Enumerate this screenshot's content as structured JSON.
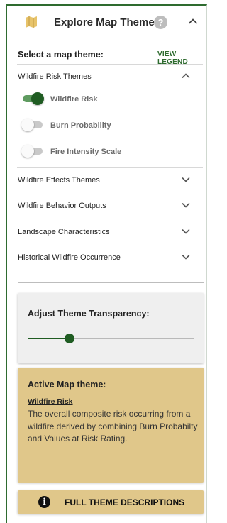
{
  "header": {
    "title": "Explore Map Themes",
    "help_glyph": "?",
    "icon": "map-icon"
  },
  "select": {
    "label": "Select a map theme:",
    "legend_link": "VIEW LEGEND"
  },
  "sections": [
    {
      "title": "Wildfire Risk Themes",
      "expanded": true,
      "toggles": [
        {
          "label": "Wildfire Risk",
          "on": true
        },
        {
          "label": "Burn Probability",
          "on": false
        },
        {
          "label": "Fire Intensity Scale",
          "on": false
        }
      ]
    },
    {
      "title": "Wildfire Effects Themes",
      "expanded": false
    },
    {
      "title": "Wildfire Behavior Outputs",
      "expanded": false
    },
    {
      "title": "Landscape Characteristics",
      "expanded": false
    },
    {
      "title": "Historical Wildfire Occurrence",
      "expanded": false
    }
  ],
  "transparency": {
    "label": "Adjust Theme Transparency:",
    "value_fraction": 0.25
  },
  "active_theme": {
    "heading": "Active Map theme:",
    "name": "Wildfire Risk",
    "description": "The overall composite risk occurring from a wildfire derived by combining Burn Probabilty and Values at Risk Rating."
  },
  "full_descriptions_button": {
    "label": "FULL THEME DESCRIPTIONS",
    "icon": "info-icon"
  },
  "colors": {
    "accent": "#2e6b2f",
    "card_tan": "#e0c78a",
    "map_icon": "#e7c36a"
  }
}
